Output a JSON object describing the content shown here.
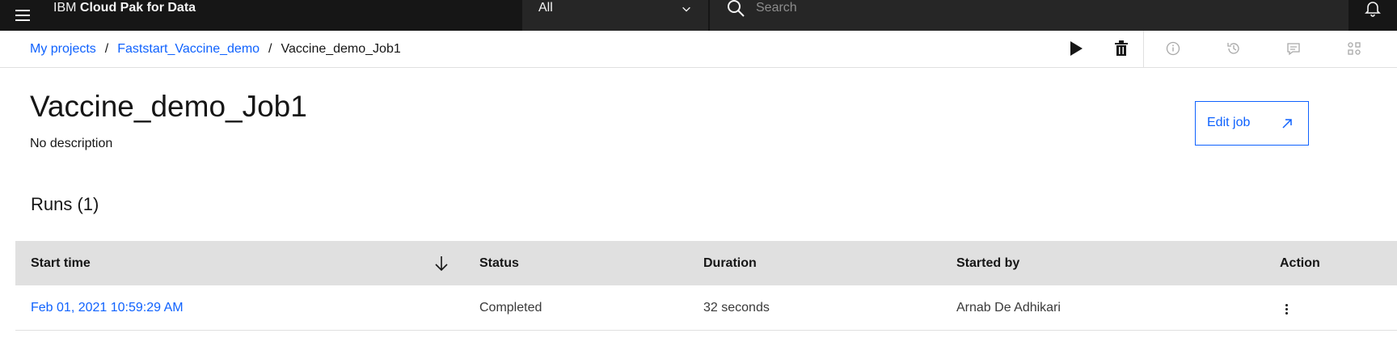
{
  "header": {
    "brand_prefix": "IBM",
    "brand_name": "Cloud Pak for Data",
    "scope_value": "All",
    "search_placeholder": "Search"
  },
  "breadcrumb": {
    "items": [
      "My projects",
      "Faststart_Vaccine_demo"
    ],
    "current": "Vaccine_demo_Job1",
    "separator": "/"
  },
  "toolbar": {
    "icons": [
      "run-icon",
      "delete-icon",
      "info-icon",
      "history-icon",
      "comments-icon",
      "apps-icon"
    ]
  },
  "job": {
    "title": "Vaccine_demo_Job1",
    "description": "No description",
    "edit_label": "Edit job"
  },
  "runs": {
    "heading": "Runs (1)",
    "columns": [
      "Start time",
      "Status",
      "Duration",
      "Started by",
      "Action"
    ],
    "rows": [
      {
        "start_time": "Feb 01, 2021 10:59:29 AM",
        "status": "Completed",
        "duration": "32 seconds",
        "started_by": "Arnab De Adhikari"
      }
    ]
  },
  "colors": {
    "accent": "#0f62fe",
    "topbar": "#161616",
    "header_bg": "#e0e0e0"
  }
}
